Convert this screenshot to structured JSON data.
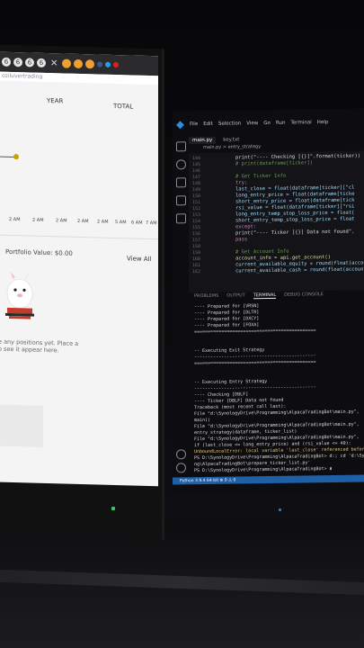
{
  "left_screen": {
    "browser_tab_bubbles": [
      "6",
      "6",
      "6",
      "6"
    ],
    "tab_close": "✕",
    "url_text": "oziluvertrading",
    "header_year": "YEAR",
    "header_total": "TOTAL",
    "x_ticks": [
      "2 AM",
      "2 AM",
      "2 AM",
      "2 AM",
      "2 AM",
      "5 AM",
      "6 AM",
      "7 AM"
    ],
    "portfolio_value": "Portfolio Value: $0.00",
    "view_all": "View All",
    "empty_line1": "e any positions yet. Place a",
    "empty_line2": "o see it appear here."
  },
  "vscode": {
    "menu": [
      "File",
      "Edit",
      "Selection",
      "View",
      "Go",
      "Run",
      "Terminal",
      "Help"
    ],
    "tabs": [
      "main.py",
      "key.txt"
    ],
    "breadcrumb": "main.py > entry_strategy",
    "line_numbers": [
      "144",
      "145",
      "146",
      "147",
      "148",
      "149",
      "150",
      "151",
      "152",
      "153",
      "154",
      "155",
      "156",
      "157",
      "158",
      "159",
      "160",
      "161",
      "162",
      "163",
      "164",
      "165",
      "166"
    ],
    "code_lines": [
      {
        "text": "print(\"---- Checking [{}]\".format(ticker))",
        "color": "#d8d8d8"
      },
      {
        "text": "# print(dataframe[ticker])",
        "color": "#6a9955"
      },
      {
        "text": "",
        "color": "#d8d8d8"
      },
      {
        "text": "# Get Ticker Info",
        "color": "#6a9955"
      },
      {
        "text": "try:",
        "color": "#c586c0"
      },
      {
        "text": "    last_close = float(dataframe[ticker][\"cl",
        "color": "#9cdcfe"
      },
      {
        "text": "    long_entry_price = float(dataframe[ticke",
        "color": "#9cdcfe"
      },
      {
        "text": "    short_entry_price = float(dataframe[tick",
        "color": "#9cdcfe"
      },
      {
        "text": "    rsi_value = float(dataframe[ticker][\"rsi",
        "color": "#9cdcfe"
      },
      {
        "text": "    long_entry_temp_stop_loss_price = float(",
        "color": "#9cdcfe"
      },
      {
        "text": "    short_entry_temp_stop_loss_price = float",
        "color": "#9cdcfe"
      },
      {
        "text": "except:",
        "color": "#c586c0"
      },
      {
        "text": "    print(\"---- Ticker [{}] Data not found\".",
        "color": "#d8d8d8"
      },
      {
        "text": "    pass",
        "color": "#c586c0"
      },
      {
        "text": "",
        "color": "#d8d8d8"
      },
      {
        "text": "# Get Account Info",
        "color": "#6a9955"
      },
      {
        "text": "account_info = api.get_account()",
        "color": "#dcdcaa"
      },
      {
        "text": "current_available_equity = round(float(account",
        "color": "#9cdcfe"
      },
      {
        "text": "current_available_cash = round(float(account_",
        "color": "#9cdcfe"
      }
    ],
    "panel_tabs": [
      "PROBLEMS",
      "OUTPUT",
      "TERMINAL",
      "DEBUG CONSOLE"
    ],
    "terminal_lines": [
      {
        "text": "---- Prepared for [VRSN]",
        "warn": false
      },
      {
        "text": "---- Prepared for [DLTR]",
        "warn": false
      },
      {
        "text": "---- Prepared for [DXCY]",
        "warn": false
      },
      {
        "text": "---- Prepared for [FOXA]",
        "warn": false
      },
      {
        "text": "=============================================",
        "warn": false
      },
      {
        "text": "",
        "warn": false
      },
      {
        "text": "",
        "warn": false
      },
      {
        "text": "-- Executing Exit Strategy",
        "warn": false
      },
      {
        "text": "---------------------------------------------",
        "warn": false
      },
      {
        "text": "=============================================",
        "warn": false
      },
      {
        "text": "",
        "warn": false
      },
      {
        "text": "",
        "warn": false
      },
      {
        "text": "-- Executing Entry Strategy",
        "warn": false
      },
      {
        "text": "---------------------------------------------",
        "warn": false
      },
      {
        "text": "---- Checking [DBLF]",
        "warn": false
      },
      {
        "text": "---- Ticker [DBLF] Data not found",
        "warn": false
      },
      {
        "text": "Traceback (most recent call last):",
        "warn": false
      },
      {
        "text": "  File \"d:\\SynologyDrive\\Programming\\AlpacaTradingBot\\main.py\",",
        "warn": false
      },
      {
        "text": "    main()",
        "warn": false
      },
      {
        "text": "  File \"d:\\SynologyDrive\\Programming\\AlpacaTradingBot\\main.py\",",
        "warn": false
      },
      {
        "text": "    entry_strategy(dataframe, ticker_list)",
        "warn": false
      },
      {
        "text": "  File \"d:\\SynologyDrive\\Programming\\AlpacaTradingBot\\main.py\",",
        "warn": false
      },
      {
        "text": "    if (last_close <= long_entry_price) and (rsi_value <= 40):",
        "warn": false
      },
      {
        "text": "UnboundLocalError: local variable 'last_close' referenced before",
        "warn": true
      },
      {
        "text": "PS D:\\SynologyDrive\\Programming\\AlpacaTradingBot> d:; cd 'd:\\Syn",
        "warn": false
      },
      {
        "text": "ng\\AlpacaTradingBot\\prepare_ticker_list.py'",
        "warn": false
      },
      {
        "text": "PS D:\\SynologyDrive\\Programming\\AlpacaTradingBot> ▮",
        "warn": false
      }
    ],
    "status_text": "Python 3.9.4 64-bit   ⊗ 0  ⚠ 0"
  }
}
